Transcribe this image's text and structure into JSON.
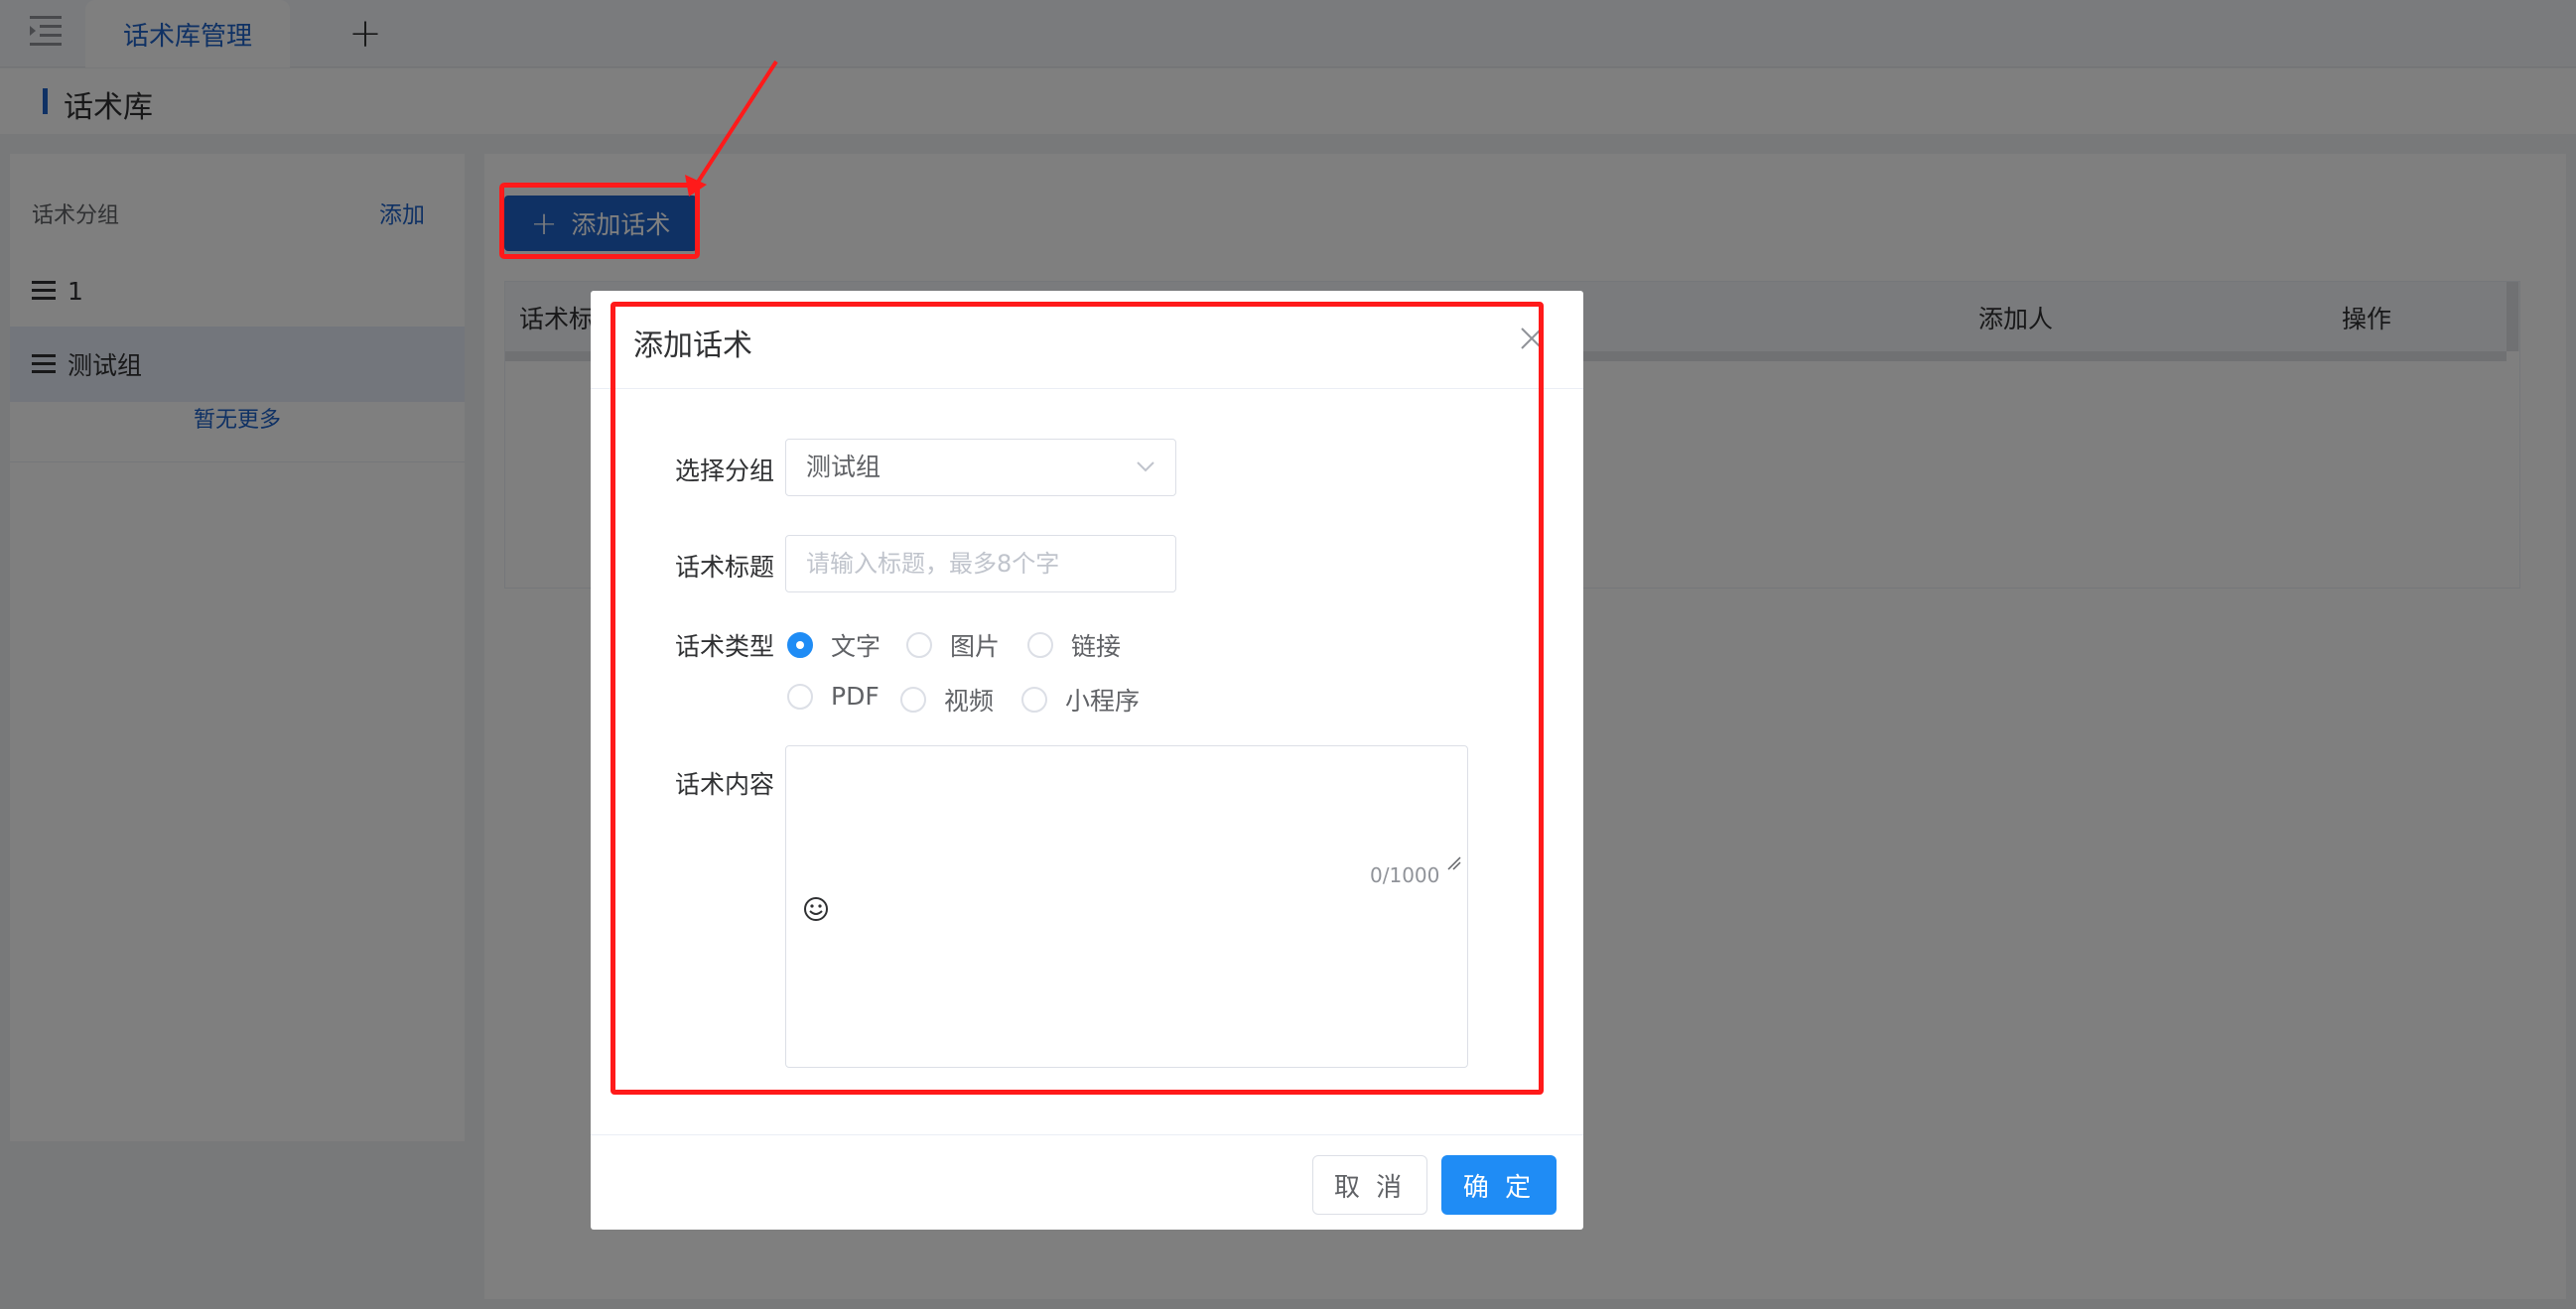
{
  "tabs": {
    "active_label": "话术库管理",
    "add_label": "+"
  },
  "page": {
    "title": "话术库"
  },
  "sidebar": {
    "header_label": "话术分组",
    "add_label": "添加",
    "groups": [
      {
        "label": "1",
        "selected": false
      },
      {
        "label": "测试组",
        "selected": true
      }
    ],
    "no_more_label": "暂无更多"
  },
  "toolbar": {
    "add_script_label": "添加话术",
    "add_icon": "plus-icon"
  },
  "table": {
    "columns": [
      "话术标",
      "添加人",
      "操作"
    ]
  },
  "dialog": {
    "title": "添加话术",
    "fields": {
      "group_label": "选择分组",
      "group_value": "测试组",
      "title_label": "话术标题",
      "title_placeholder": "请输入标题，最多8个字",
      "type_label": "话术类型",
      "types": [
        "文字",
        "图片",
        "链接",
        "PDF",
        "视频",
        "小程序"
      ],
      "selected_type": "文字",
      "content_label": "话术内容",
      "content_counter": "0/1000"
    },
    "cancel_label": "取 消",
    "confirm_label": "确 定"
  },
  "colors": {
    "primary": "#1f62c8",
    "dialog_primary": "#1f8cf5",
    "annotation_red": "#ff1a1a",
    "overlay": "rgba(0,0,0,0.5)"
  }
}
